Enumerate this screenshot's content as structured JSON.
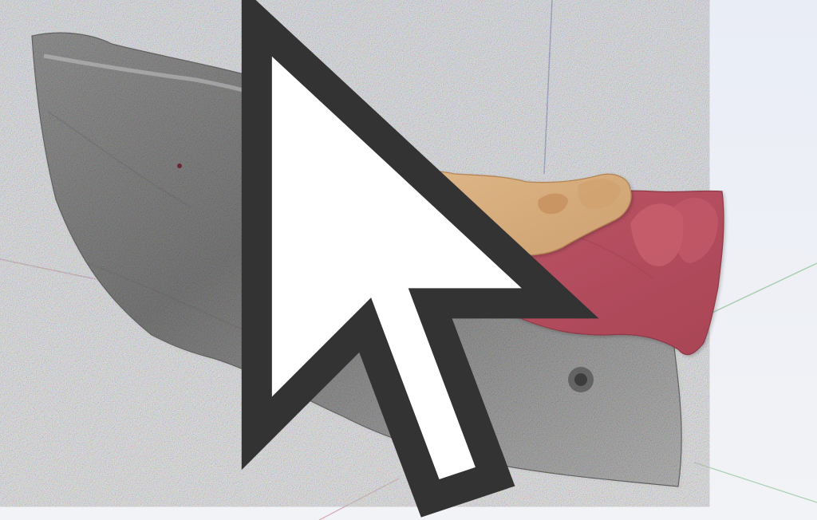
{
  "viewport": {
    "view": "3d-perspective",
    "background_top": "#e9edf6",
    "background_bottom": "#f2f3f6",
    "axes": {
      "x_color": "#d3a7b3",
      "y_color": "#7f86c9",
      "z_color": "#a7cfb1"
    }
  },
  "scene": {
    "objects": [
      {
        "icon": "mandible-bone-model",
        "color": "#8a8a8a"
      },
      {
        "icon": "gingiva-soft-tissue-model",
        "color": "#b34d5d"
      },
      {
        "icon": "surgical-guide-model",
        "color": "#d8ad7c"
      }
    ]
  },
  "cursor": {
    "icon": "arrow-cursor-icon"
  }
}
